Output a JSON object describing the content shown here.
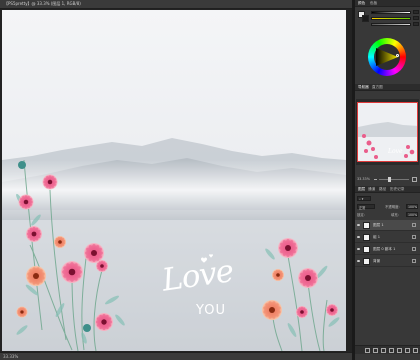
{
  "document": {
    "tab_title": "【PS5pretty】@ 33.3% (图层 1, RGB/8)",
    "status": "33.33%"
  },
  "panels": {
    "color_tabs": [
      "颜色",
      "色板"
    ],
    "navigator_tabs": [
      "导航器",
      "直方图"
    ],
    "zoom_value": "33.33%",
    "layers_tabs": [
      "图层",
      "通道",
      "路径",
      "历史记录"
    ],
    "blend_mode": "正常",
    "opacity_label": "不透明度:",
    "opacity_value": "100%",
    "lock_label": "锁定:",
    "fill_label": "填充:",
    "fill_value": "100%"
  },
  "layers": [
    {
      "name": "图层 1",
      "selected": true
    },
    {
      "name": "组 1",
      "selected": false
    },
    {
      "name": "图层 0 副本 1",
      "selected": false
    },
    {
      "name": "背景",
      "selected": false
    }
  ],
  "artwork": {
    "love_text": "Love",
    "you_text": "YOU"
  },
  "colors": {
    "foreground": "#e8e8e8",
    "background": "#1b1b1b",
    "accent_red": "#e03a3a",
    "panel_bg": "#383838"
  },
  "icons": [
    "eye-icon",
    "link-icon",
    "fx-icon",
    "mask-icon",
    "new-layer-icon",
    "trash-icon",
    "folder-icon"
  ]
}
